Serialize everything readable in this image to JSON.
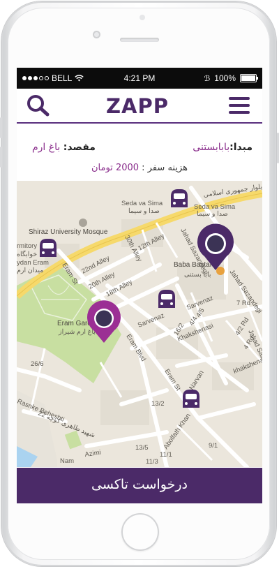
{
  "status_bar": {
    "carrier": "BELL",
    "time": "4:21 PM",
    "battery": "100%"
  },
  "header": {
    "logo_text": "ZAPP",
    "search_icon": "search-icon",
    "menu_icon": "hamburger-menu-icon"
  },
  "trip": {
    "origin_label": "مبدا:",
    "origin_value": "بابابستنی",
    "destination_label": "مقصد:",
    "destination_value": "باغ ارم",
    "fare_label": "هزینه سفر :",
    "fare_value": "2000 تومان"
  },
  "map": {
    "labels": {
      "seda1": "Seda va Sima",
      "seda1_fa": "صدا و سیما",
      "seda2": "Seda va Sima",
      "seda2_fa": "صدا و سیما",
      "blvd_fa": "بلوار جمهوری اسلامی",
      "mosque": "Shiraz University Mosque",
      "dormitory": "rmitory",
      "dormitory_fa": "خوابگاه",
      "eram_left": "ydan Eram",
      "eram_left_fa": "میدان ارم",
      "alley22": "22nd Alley",
      "alley20": "20th Alley",
      "alley18": "18th Alley",
      "alley12": "12th Alley",
      "alley30": "30th Alley",
      "eram_st1": "Eram St",
      "eram_st2": "Eram St",
      "eram_blvd": "Eram Blvd",
      "eram_garden": "Eram Garden",
      "eram_garden_fa": "باغ ارم شیراز",
      "sarvenaz1": "Sarvenaz",
      "sarvenaz2": "Sarvenaz",
      "jahad1": "Jahad Sazandegi",
      "jahad2": "Jahad Sazandegi",
      "jahad3": "Jahad Sazandegi",
      "baba_bastani": "Baba Bastani",
      "baba_bastani_fa": "بابا بستنی",
      "khakshenasi1": "Khakshenasi",
      "khakshenasi2": "khakshenasi",
      "narvan": "Narvan",
      "abolfath": "Abolfath Khan",
      "rasnke": "Rasnke Beheshti",
      "kooche22": "22 شهید طاهری کوچه",
      "azimi": "Azimi",
      "nam": "Nam",
      "n7rd": "7 Rd",
      "n45": "4/5",
      "n44": "4/4",
      "n42": "4/2 Rd",
      "n4": "4 Rd",
      "n162": "16/2",
      "n132": "13/2",
      "n135": "13/5",
      "n111": "11/1",
      "n113": "11/3",
      "n91": "9/1",
      "n266": "26/6"
    }
  },
  "request_button": {
    "label": "درخواست تاکسی"
  },
  "colors": {
    "brand": "#4b2a68",
    "accent": "#8a2e8c",
    "park": "#c8dfa1"
  }
}
